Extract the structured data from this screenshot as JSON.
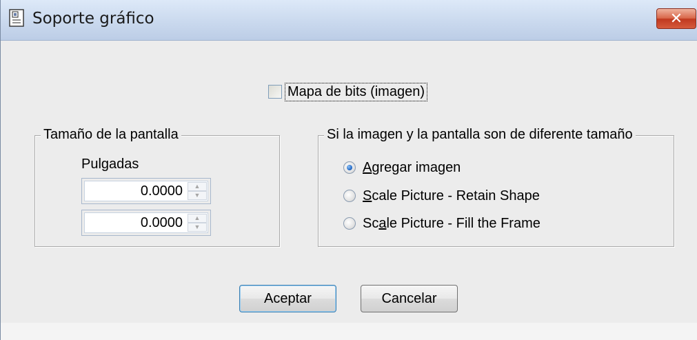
{
  "window": {
    "title": "Soporte gráfico",
    "close_glyph": "✕",
    "icon": "dialog-app-icon"
  },
  "bitmap_checkbox": {
    "label": "Mapa de bits (imagen)",
    "checked": false
  },
  "screen_size_group": {
    "title": "Tamaño de la pantalla",
    "units_label": "Pulgadas",
    "fields": [
      {
        "value": "0.0000"
      },
      {
        "value": "0.0000"
      }
    ]
  },
  "size_mismatch_group": {
    "title": "Si la imagen y la pantalla son de diferente tamaño",
    "options": [
      {
        "mnemonic": "A",
        "rest": "gregar imagen",
        "pre": "",
        "selected": true
      },
      {
        "mnemonic": "S",
        "rest": "cale Picture - Retain Shape",
        "pre": "",
        "selected": false
      },
      {
        "pre": "Sc",
        "mnemonic": "a",
        "rest": "le Picture - Fill the Frame",
        "selected": false
      }
    ]
  },
  "buttons": {
    "ok": "Aceptar",
    "cancel": "Cancelar"
  },
  "colors": {
    "title_bar": "#cad9ee",
    "close_button": "#c0391f",
    "dialog_bg": "#ececec",
    "radio_selected": "#2a6fc9"
  }
}
